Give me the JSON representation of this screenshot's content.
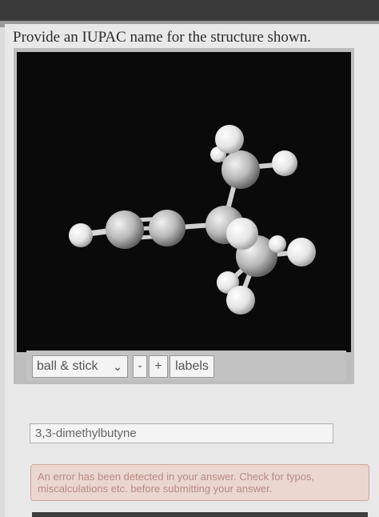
{
  "question": {
    "text": "Provide an IUPAC name for the structure shown."
  },
  "viewer_controls": {
    "render_mode": "ball & stick",
    "zoom_out": "-",
    "zoom_in": "+",
    "labels": "labels"
  },
  "answer": {
    "value": "3,3-dimethylbutyne"
  },
  "error": {
    "line1": "An error has been detected in your answer. Check for typos,",
    "line2": "miscalculations etc. before submitting your answer."
  },
  "icons": {
    "select_arrow": "chevron-down-icon"
  }
}
